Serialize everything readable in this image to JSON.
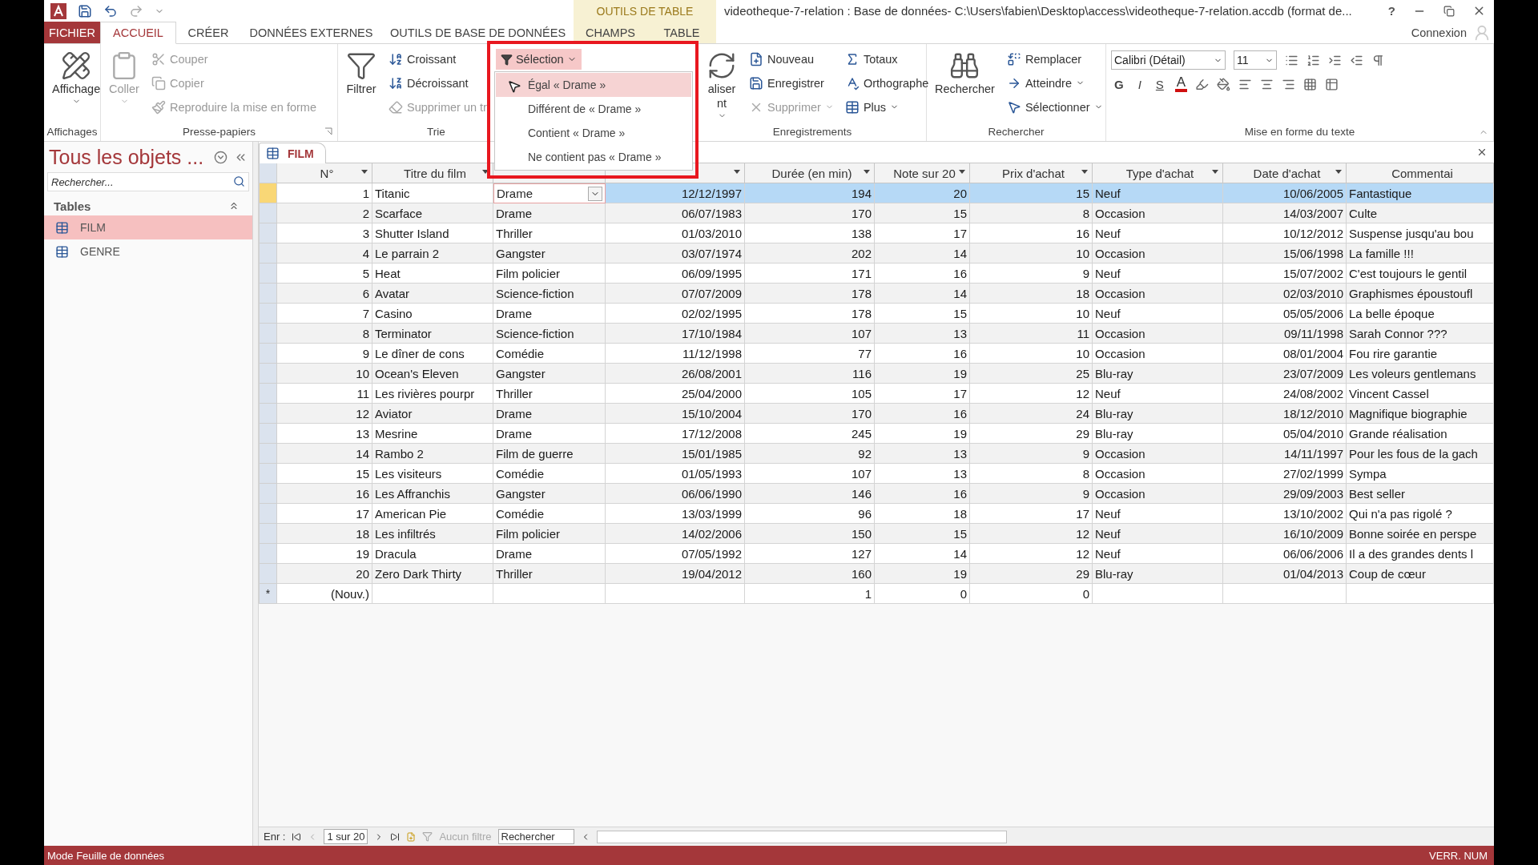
{
  "title_bar": {
    "context_group": "OUTILS DE TABLE",
    "title": "videotheque-7-relation : Base de données- C:\\Users\\fabien\\Desktop\\access\\videotheque-7-relation.accdb (format de...",
    "help": "?"
  },
  "ribbon_tabs": [
    {
      "label": "FICHIER",
      "kind": "file",
      "selected": false
    },
    {
      "label": "ACCUEIL",
      "kind": "main",
      "selected": true
    },
    {
      "label": "CRÉER",
      "kind": "main",
      "selected": false
    },
    {
      "label": "DONNÉES EXTERNES",
      "kind": "main",
      "selected": false
    },
    {
      "label": "OUTILS DE BASE DE DONNÉES",
      "kind": "main",
      "selected": false
    },
    {
      "label": "CHAMPS",
      "kind": "context",
      "selected": false
    },
    {
      "label": "TABLE",
      "kind": "context",
      "selected": false
    }
  ],
  "account": "Connexion",
  "ribbon_groups": [
    {
      "label": "Affichages",
      "items": [
        {
          "kind": "large",
          "label": "Affichage",
          "caret": true,
          "disabled": false
        }
      ]
    },
    {
      "label": "Presse-papiers",
      "launcher": true,
      "items": [
        {
          "kind": "large",
          "label": "Coller",
          "caret": true,
          "disabled": true
        },
        {
          "kind": "small",
          "label": "Couper",
          "disabled": true
        },
        {
          "kind": "small",
          "label": "Copier",
          "disabled": true
        },
        {
          "kind": "small",
          "label": "Reproduire la mise en forme",
          "disabled": true
        }
      ]
    },
    {
      "label": "Trie",
      "items": [
        {
          "kind": "large",
          "label": "Filtrer",
          "disabled": false
        },
        {
          "kind": "small",
          "label": "Croissant",
          "disabled": false
        },
        {
          "kind": "small",
          "label": "Décroissant",
          "disabled": false
        },
        {
          "kind": "small",
          "label": "Supprimer un tr",
          "disabled": true
        }
      ]
    },
    {
      "label": "Enregistrements",
      "items": [
        {
          "kind": "large",
          "label": "aliser",
          "label2": "nt",
          "caret": true,
          "disabled": false
        },
        {
          "kind": "small",
          "label": "Nouveau",
          "disabled": false
        },
        {
          "kind": "small",
          "label": "Enregistrer",
          "disabled": false
        },
        {
          "kind": "small",
          "label": "Supprimer",
          "caret": true,
          "disabled": true
        },
        {
          "kind": "small",
          "label": "Totaux",
          "disabled": false
        },
        {
          "kind": "small",
          "label": "Orthographe",
          "disabled": false
        },
        {
          "kind": "small",
          "label": "Plus",
          "caret": true,
          "disabled": false
        }
      ]
    },
    {
      "label": "Rechercher",
      "items": [
        {
          "kind": "large",
          "label": "Rechercher",
          "disabled": false
        },
        {
          "kind": "small",
          "label": "Remplacer",
          "disabled": false
        },
        {
          "kind": "small",
          "label": "Atteindre",
          "caret": true,
          "disabled": false
        },
        {
          "kind": "small",
          "label": "Sélectionner",
          "caret": true,
          "disabled": false
        }
      ]
    }
  ],
  "text_format": {
    "label": "Mise en forme du texte",
    "font": "Calibri (Détail)",
    "size": "11",
    "bold": "G",
    "italic": "I",
    "underline": "S",
    "font_color": "A"
  },
  "selection_menu": {
    "button": "Sélection",
    "items": [
      {
        "label": "Égal « Drame »",
        "selected": true
      },
      {
        "label": "Différent de « Drame »",
        "selected": false
      },
      {
        "label": "Contient « Drame »",
        "selected": false
      },
      {
        "label": "Ne contient pas « Drame »",
        "selected": false
      }
    ]
  },
  "nav_pane": {
    "title": "Tous les objets ...",
    "search": {
      "placeholder": "Rechercher..."
    },
    "section": "Tables",
    "items": [
      {
        "label": "FILM",
        "selected": true
      },
      {
        "label": "GENRE",
        "selected": false
      }
    ]
  },
  "table": {
    "tab": "FILM",
    "columns": [
      {
        "label": "N°",
        "caret": true
      },
      {
        "label": "Titre du film",
        "caret": true
      },
      {
        "kind": "lookup",
        "caret": false
      },
      {
        "caret": true
      },
      {
        "label": "Durée (en min)",
        "caret": true
      },
      {
        "label": "Note sur 20",
        "caret": true
      },
      {
        "label": "Prix d'achat",
        "caret": true
      },
      {
        "label": "Type d'achat",
        "caret": true
      },
      {
        "label": "Date d'achat",
        "caret": true
      },
      {
        "label": "Commentai",
        "caret": false
      }
    ],
    "rows": [
      {
        "selected": true,
        "cells": [
          "1",
          "Titanic",
          "Drame",
          "12/12/1997",
          "194",
          "20",
          "15",
          "Neuf",
          "10/06/2005",
          "Fantastique"
        ]
      },
      {
        "selected": false,
        "cells": [
          "2",
          "Scarface",
          "Drame",
          "06/07/1983",
          "170",
          "15",
          "8",
          "Occasion",
          "14/03/2007",
          "Culte"
        ]
      },
      {
        "selected": false,
        "cells": [
          "3",
          "Shutter Island",
          "Thriller",
          "01/03/2010",
          "138",
          "17",
          "16",
          "Neuf",
          "10/12/2012",
          "Suspense jusqu'au bou"
        ]
      },
      {
        "selected": false,
        "cells": [
          "4",
          "Le parrain 2",
          "Gangster",
          "03/07/1974",
          "202",
          "14",
          "10",
          "Occasion",
          "15/06/1998",
          "La famille !!!"
        ]
      },
      {
        "selected": false,
        "cells": [
          "5",
          "Heat",
          "Film policier",
          "06/09/1995",
          "171",
          "16",
          "9",
          "Neuf",
          "15/07/2002",
          "C'est toujours le gentil"
        ]
      },
      {
        "selected": false,
        "cells": [
          "6",
          "Avatar",
          "Science-fiction",
          "07/07/2009",
          "178",
          "14",
          "18",
          "Occasion",
          "02/03/2010",
          "Graphismes époustoufl"
        ]
      },
      {
        "selected": false,
        "cells": [
          "7",
          "Casino",
          "Drame",
          "02/02/1995",
          "178",
          "15",
          "10",
          "Neuf",
          "05/05/2006",
          "La belle époque"
        ]
      },
      {
        "selected": false,
        "cells": [
          "8",
          "Terminator",
          "Science-fiction",
          "17/10/1984",
          "107",
          "13",
          "11",
          "Occasion",
          "09/11/1998",
          "Sarah Connor ???"
        ]
      },
      {
        "selected": false,
        "cells": [
          "9",
          "Le dîner de cons",
          "Comédie",
          "11/12/1998",
          "77",
          "16",
          "10",
          "Occasion",
          "08/01/2004",
          "Fou rire garantie"
        ]
      },
      {
        "selected": false,
        "cells": [
          "10",
          "Ocean's Eleven",
          "Gangster",
          "26/08/2001",
          "116",
          "19",
          "25",
          "Blu-ray",
          "23/07/2009",
          "Les voleurs gentlemans"
        ]
      },
      {
        "selected": false,
        "cells": [
          "11",
          "Les rivières pourpr",
          "Thriller",
          "25/04/2000",
          "105",
          "17",
          "12",
          "Neuf",
          "24/08/2002",
          "Vincent Cassel"
        ]
      },
      {
        "selected": false,
        "cells": [
          "12",
          "Aviator",
          "Drame",
          "15/10/2004",
          "170",
          "16",
          "24",
          "Blu-ray",
          "18/12/2010",
          "Magnifique biographie"
        ]
      },
      {
        "selected": false,
        "cells": [
          "13",
          "Mesrine",
          "Drame",
          "17/12/2008",
          "245",
          "19",
          "29",
          "Blu-ray",
          "05/04/2010",
          "Grande réalisation"
        ]
      },
      {
        "selected": false,
        "cells": [
          "14",
          "Rambo 2",
          "Film de guerre",
          "15/01/1985",
          "92",
          "13",
          "9",
          "Occasion",
          "14/11/1997",
          "Pour les fous de la gach"
        ]
      },
      {
        "selected": false,
        "cells": [
          "15",
          "Les visiteurs",
          "Comédie",
          "01/05/1993",
          "107",
          "13",
          "8",
          "Occasion",
          "27/02/1999",
          "Sympa"
        ]
      },
      {
        "selected": false,
        "cells": [
          "16",
          "Les Affranchis",
          "Gangster",
          "06/06/1990",
          "146",
          "16",
          "9",
          "Occasion",
          "29/09/2003",
          "Best seller"
        ]
      },
      {
        "selected": false,
        "cells": [
          "17",
          "American Pie",
          "Comédie",
          "13/03/1999",
          "96",
          "18",
          "17",
          "Neuf",
          "13/10/2002",
          "Qui n'a pas rigolé ?"
        ]
      },
      {
        "selected": false,
        "cells": [
          "18",
          "Les infiltrés",
          "Film policier",
          "14/02/2006",
          "150",
          "15",
          "12",
          "Neuf",
          "16/10/2009",
          "Bonne soirée en perspe"
        ]
      },
      {
        "selected": false,
        "cells": [
          "19",
          "Dracula",
          "Drame",
          "07/05/1992",
          "127",
          "14",
          "12",
          "Neuf",
          "06/06/2006",
          "Il a des grandes dents l"
        ]
      },
      {
        "selected": false,
        "cells": [
          "20",
          "Zero Dark Thirty",
          "Thriller",
          "19/04/2012",
          "160",
          "19",
          "29",
          "Blu-ray",
          "01/04/2013",
          "Coup de cœur"
        ]
      }
    ],
    "new_row": {
      "marker": "*",
      "cells": [
        "(Nouv.)",
        "",
        "",
        "",
        "1",
        "0",
        "0",
        "",
        "",
        ""
      ]
    }
  },
  "record_nav": {
    "label": "Enr :",
    "position": "1 sur 20",
    "filter": "Aucun filtre",
    "search": "Rechercher"
  },
  "status_bar": {
    "mode": "Mode Feuille de données",
    "indicator": "VERR. NUM"
  }
}
